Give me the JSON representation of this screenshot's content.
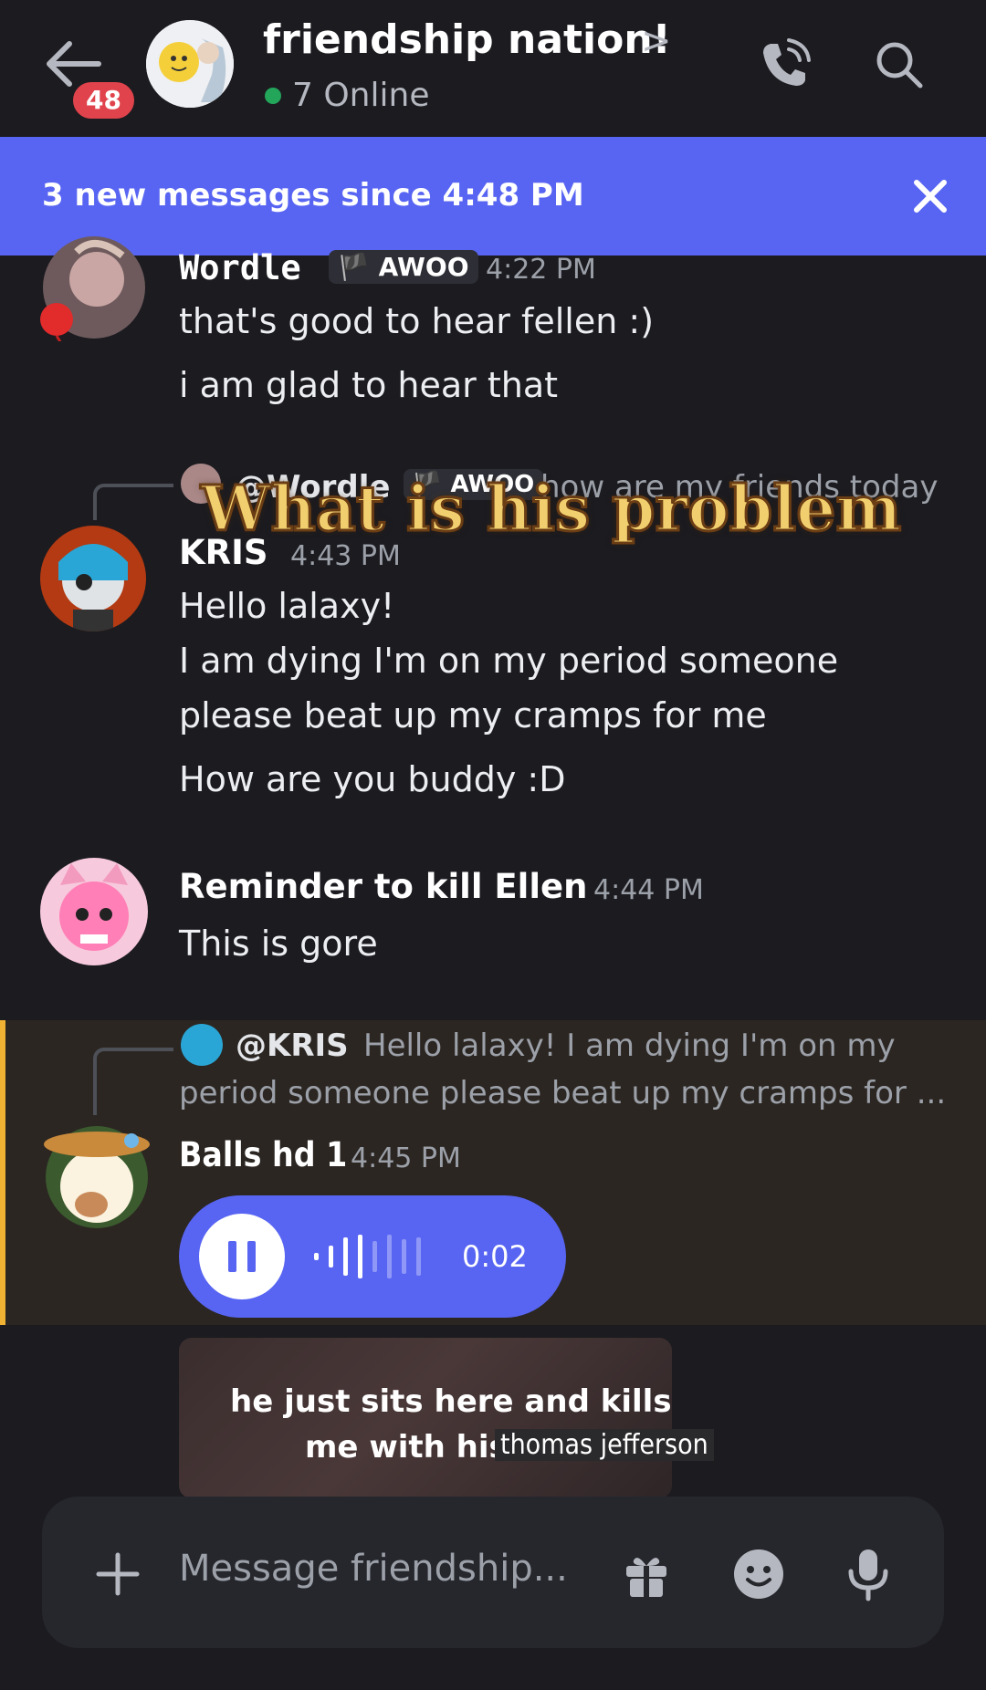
{
  "header": {
    "badge_count": "48",
    "channel_title": "friendship nation!",
    "title_chevron": ">",
    "online_count": "7 Online",
    "online_color": "#23a55a",
    "icons": [
      "back-arrow-icon",
      "phone-call-icon",
      "search-icon"
    ]
  },
  "banner": {
    "text": "3 new messages since 4:48 PM",
    "close": "✕",
    "color": "#5865f2"
  },
  "overlay_caption": "What is his problem",
  "messages": [
    {
      "username": "Wordle",
      "tag": "AWOO",
      "time": "4:22 PM",
      "lines": [
        "that's good to hear fellen :)",
        "i am glad to hear that"
      ]
    },
    {
      "reply": {
        "mention": "@Wordle",
        "tag": "AWOO",
        "text": "how are my friends today"
      },
      "username": "KRIS",
      "time": "4:43 PM",
      "lines": [
        "Hello lalaxy!",
        "I am dying I'm on my period someone",
        "please beat up my cramps for me",
        "How are you buddy :D"
      ]
    },
    {
      "username": "Reminder to kill Ellen",
      "time": "4:44 PM",
      "lines": [
        "This is gore"
      ]
    },
    {
      "reply": {
        "mention": "@KRIS",
        "text1": "Hello lalaxy! I am dying I'm on my",
        "text2": "period someone please beat up my cramps for ..."
      },
      "username": "Balls hd 1",
      "time": "4:45 PM",
      "voice": {
        "duration": "0:02"
      },
      "highlight_color": "#f0b232"
    }
  ],
  "meme": {
    "line1": "he just sits here and kills",
    "line2a": "me with his",
    "line2b": "thomas jefferson"
  },
  "composer": {
    "placeholder": "Message friendship...",
    "icons": [
      "plus-icon",
      "gift-icon",
      "emoji-icon",
      "microphone-icon"
    ]
  }
}
